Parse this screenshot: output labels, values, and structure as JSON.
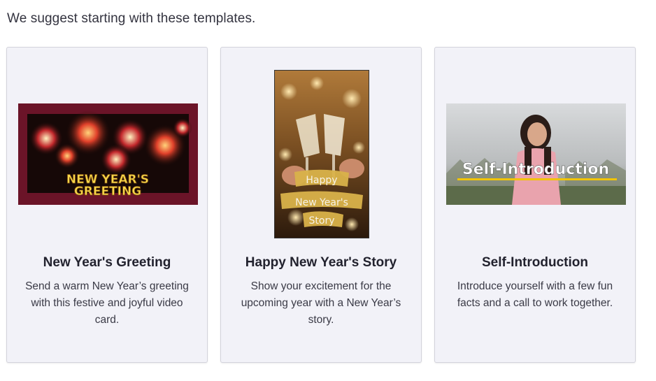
{
  "intro_text": "We suggest starting with these templates.",
  "templates": [
    {
      "title": "New Year's Greeting",
      "description": "Send a warm New Year’s greeting with this festive and joyful video card.",
      "thumb_text": [
        "NEW YEAR'S",
        "GREETING"
      ]
    },
    {
      "title": "Happy New Year's Story",
      "description": "Show your excitement for the upcoming year with a New Year’s story.",
      "thumb_text": [
        "Happy",
        "New Year's",
        "Story"
      ]
    },
    {
      "title": "Self-Introduction",
      "description": "Introduce yourself with a few fun facts and a call to work together.",
      "thumb_text": [
        "Self-Introduction"
      ]
    }
  ],
  "colors": {
    "card_bg": "#f2f2f8",
    "card_border": "#d3d3dc",
    "maroon": "#6b1428",
    "gold": "#d9b24a"
  }
}
